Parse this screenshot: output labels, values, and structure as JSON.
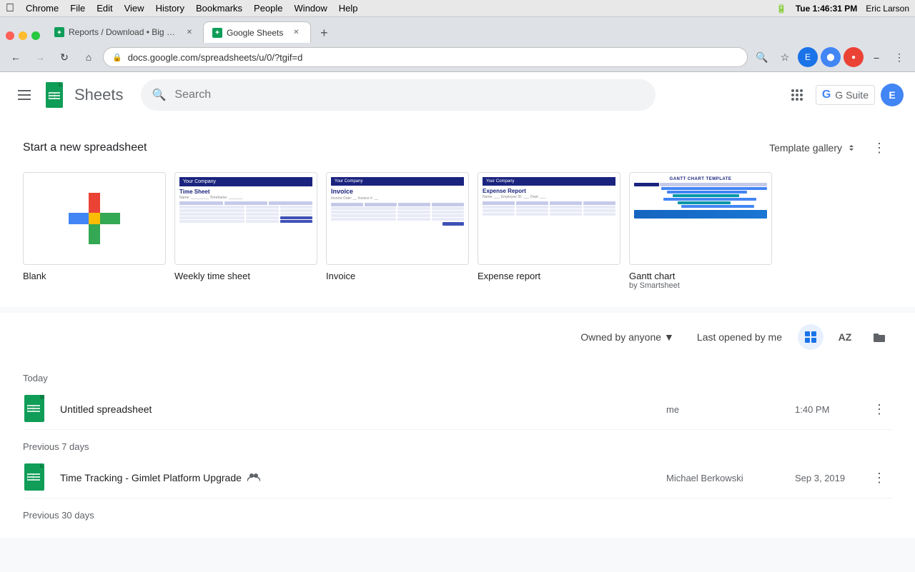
{
  "menubar": {
    "apple": "🍎",
    "items": [
      "Chrome",
      "File",
      "Edit",
      "View",
      "History",
      "Bookmarks",
      "People",
      "Window",
      "Help"
    ],
    "right": {
      "time": "Tue 1:46:31 PM",
      "user": "Eric Larson",
      "battery": "88%"
    }
  },
  "browser": {
    "tabs": [
      {
        "id": "tab1",
        "favicon_color": "#0f9d58",
        "label": "Reports / Download • Big Cam...",
        "active": false
      },
      {
        "id": "tab2",
        "favicon_color": "#0f9d58",
        "label": "Google Sheets",
        "active": true
      }
    ],
    "address_url": "docs.google.com/spreadsheets/u/0/?tgif=d",
    "search_icon": "🔍",
    "star_icon": "☆",
    "back_disabled": false,
    "forward_disabled": false
  },
  "header": {
    "app_name": "Sheets",
    "search_placeholder": "Search",
    "gsuite_label": "G Suite",
    "user_initial": "E"
  },
  "templates_section": {
    "title": "Start a new spreadsheet",
    "gallery_label": "Template gallery",
    "more_icon": "⋮",
    "templates": [
      {
        "id": "blank",
        "label": "Blank",
        "sublabel": ""
      },
      {
        "id": "timesheet",
        "label": "Weekly time sheet",
        "sublabel": ""
      },
      {
        "id": "invoice",
        "label": "Invoice",
        "sublabel": ""
      },
      {
        "id": "expense",
        "label": "Expense report",
        "sublabel": ""
      },
      {
        "id": "gantt",
        "label": "Gantt chart",
        "sublabel": "by Smartsheet"
      }
    ]
  },
  "files_section": {
    "period_today": "Today",
    "period_7days": "Previous 7 days",
    "period_30days": "Previous 30 days",
    "owner_filter_label": "Owned by anyone",
    "sort_label": "Last opened by me",
    "files_today": [
      {
        "id": "file1",
        "name": "Untitled spreadsheet",
        "owner": "me",
        "date": "1:40 PM",
        "shared": false
      }
    ],
    "files_7days": [
      {
        "id": "file2",
        "name": "Time Tracking - Gimlet Platform Upgrade",
        "owner": "Michael Berkowski",
        "date": "Sep 3, 2019",
        "shared": true
      }
    ],
    "files_30days": []
  }
}
